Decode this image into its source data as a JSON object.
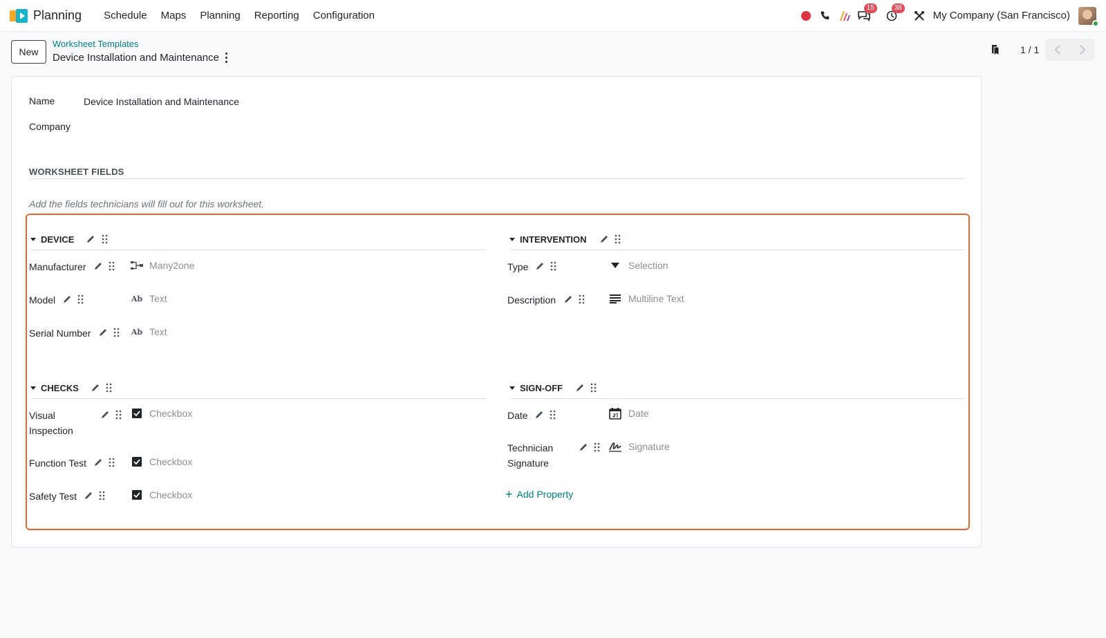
{
  "navbar": {
    "app_name": "Planning",
    "menu": [
      "Schedule",
      "Maps",
      "Planning",
      "Reporting",
      "Configuration"
    ],
    "chat_badge": "15",
    "activity_badge": "38",
    "company": "My Company (San Francisco)"
  },
  "control_panel": {
    "new_label": "New",
    "breadcrumb_parent": "Worksheet Templates",
    "breadcrumb_current": "Device Installation and Maintenance",
    "pager": "1 / 1"
  },
  "form": {
    "name_label": "Name",
    "name_value": "Device Installation and Maintenance",
    "company_label": "Company",
    "section_title": "WORKSHEET FIELDS",
    "hint": "Add the fields technicians will fill out for this worksheet."
  },
  "groups": {
    "device": {
      "title": "DEVICE",
      "props": [
        {
          "label": "Manufacturer",
          "type": "Many2one"
        },
        {
          "label": "Model",
          "type": "Text"
        },
        {
          "label": "Serial Number",
          "type": "Text"
        }
      ]
    },
    "intervention": {
      "title": "INTERVENTION",
      "props": [
        {
          "label": "Type",
          "type": "Selection"
        },
        {
          "label": "Description",
          "type": "Multiline Text"
        }
      ]
    },
    "checks": {
      "title": "CHECKS",
      "props": [
        {
          "label": "Visual Inspection",
          "type": "Checkbox"
        },
        {
          "label": "Function Test",
          "type": "Checkbox"
        },
        {
          "label": "Safety Test",
          "type": "Checkbox"
        }
      ]
    },
    "signoff": {
      "title": "SIGN-OFF",
      "props": [
        {
          "label": "Date",
          "type": "Date"
        },
        {
          "label": "Technician Signature",
          "type": "Signature"
        }
      ]
    }
  },
  "add_property_label": "Add Property",
  "colors": {
    "accent": "#017e84",
    "highlight_border": "#e2672f",
    "badge": "#e04e5b",
    "record": "#dc3545"
  }
}
